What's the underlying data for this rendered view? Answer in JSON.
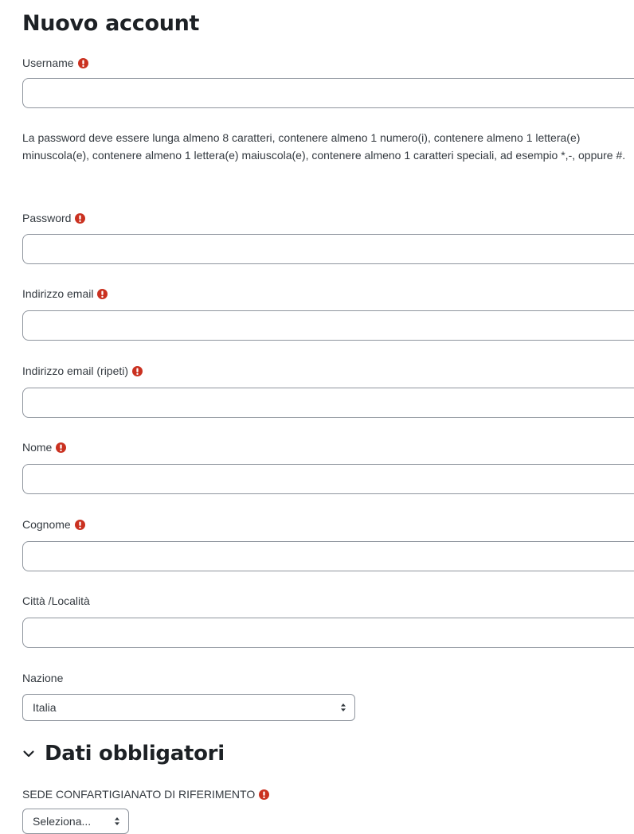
{
  "page": {
    "title": "Nuovo account"
  },
  "form": {
    "username": {
      "label": "Username",
      "value": "",
      "placeholder": ""
    },
    "password_policy": "La password deve essere lunga almeno 8 caratteri, contenere almeno 1 numero(i), contenere almeno 1 lettera(e) minuscola(e), contenere almeno 1 lettera(e) maiuscola(e), contenere almeno 1 caratteri speciali, ad esempio *,-, oppure #.",
    "password": {
      "label": "Password",
      "value": "",
      "placeholder": ""
    },
    "email": {
      "label": "Indirizzo email",
      "value": "",
      "placeholder": ""
    },
    "email_repeat": {
      "label": "Indirizzo email (ripeti)",
      "value": "",
      "placeholder": ""
    },
    "firstname": {
      "label": "Nome",
      "value": "",
      "placeholder": ""
    },
    "lastname": {
      "label": "Cognome",
      "value": "",
      "placeholder": ""
    },
    "city": {
      "label": "Città /Località",
      "value": "",
      "placeholder": ""
    },
    "country": {
      "label": "Nazione",
      "selected": "Italia"
    }
  },
  "section": {
    "title": "Dati obbligatori",
    "sede": {
      "label": "SEDE CONFARTIGIANATO DI RIFERIMENTO",
      "selected": "Seleziona..."
    }
  },
  "icons": {
    "required": "exclamation-circle-icon",
    "section_toggle": "chevron-down-icon",
    "select_caret": "sort-caret-icon"
  },
  "colors": {
    "required": "#ca3120",
    "border": "#8f959e",
    "text": "#343a40",
    "heading": "#1d2125"
  }
}
